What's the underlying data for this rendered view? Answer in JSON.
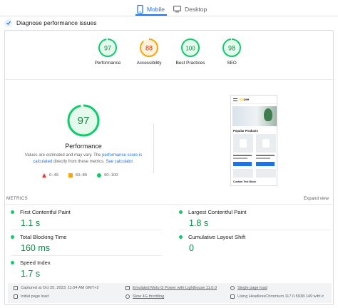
{
  "tabs": {
    "mobile": "Mobile",
    "desktop": "Desktop",
    "active": "mobile"
  },
  "diagnose": {
    "title": "Diagnose performance issues"
  },
  "colors": {
    "good": "#0cce6b",
    "average": "#ffa400",
    "poor": "#e53935",
    "accent": "#1a73e8"
  },
  "scores": [
    {
      "label": "Performance",
      "value": "97",
      "rating": "good"
    },
    {
      "label": "Accessibility",
      "value": "88",
      "rating": "average"
    },
    {
      "label": "Best Practices",
      "value": "100",
      "rating": "good"
    },
    {
      "label": "SEO",
      "value": "98",
      "rating": "good"
    }
  ],
  "performance": {
    "score": "97",
    "title": "Performance",
    "note_1": "Values are estimated and may vary. The ",
    "note_link_1": "performance score is calculated",
    "note_2": " directly from these metrics. ",
    "note_link_2": "See calculator.",
    "legend": {
      "poor": "0–49",
      "average": "50–89",
      "good": "90–100"
    }
  },
  "thumbnail": {
    "logo_prefix": "Co",
    "logo_rest": "zee",
    "popular": "Popular Products",
    "footer": "Custom Text Block"
  },
  "metrics": {
    "header": "METRICS",
    "expand": "Expand view",
    "items": [
      {
        "name": "First Contentful Paint",
        "value": "1.1 s",
        "rating": "good"
      },
      {
        "name": "Largest Contentful Paint",
        "value": "1.8 s",
        "rating": "good"
      },
      {
        "name": "Total Blocking Time",
        "value": "160 ms",
        "rating": "good"
      },
      {
        "name": "Cumulative Layout Shift",
        "value": "0",
        "rating": "good"
      },
      {
        "name": "Speed Index",
        "value": "1.7 s",
        "rating": "good"
      }
    ]
  },
  "footer": {
    "captured": "Captured at Oct 25, 2023, 11:04 AM GMT+2",
    "emulated": "Emulated Moto G Power with Lighthouse 11.0.0",
    "single_load": "Single page load",
    "initial_load": "Initial page load",
    "throttling": "Slow 4G throttling",
    "using": "Using HeadlessChromium 117.0.5938.149 with lr"
  }
}
